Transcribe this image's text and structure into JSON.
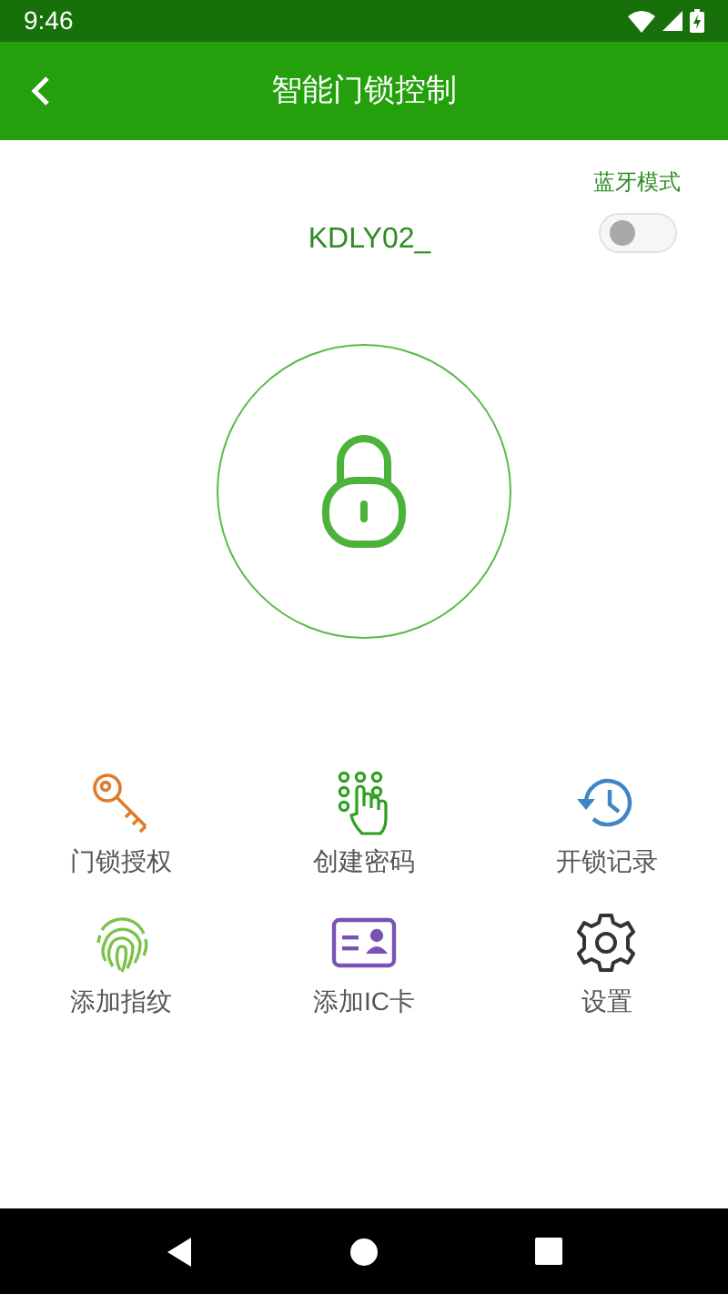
{
  "status_bar": {
    "time": "9:46"
  },
  "app_bar": {
    "title": "智能门锁控制"
  },
  "bluetooth": {
    "label": "蓝牙模式",
    "on": false
  },
  "device": {
    "name": "KDLY02_"
  },
  "actions": [
    {
      "kind": "key",
      "label": "门锁授权"
    },
    {
      "kind": "keypad",
      "label": "创建密码"
    },
    {
      "kind": "history",
      "label": "开锁记录"
    },
    {
      "kind": "fingerprint",
      "label": "添加指纹"
    },
    {
      "kind": "card",
      "label": "添加IC卡"
    },
    {
      "kind": "settings",
      "label": "设置"
    }
  ]
}
